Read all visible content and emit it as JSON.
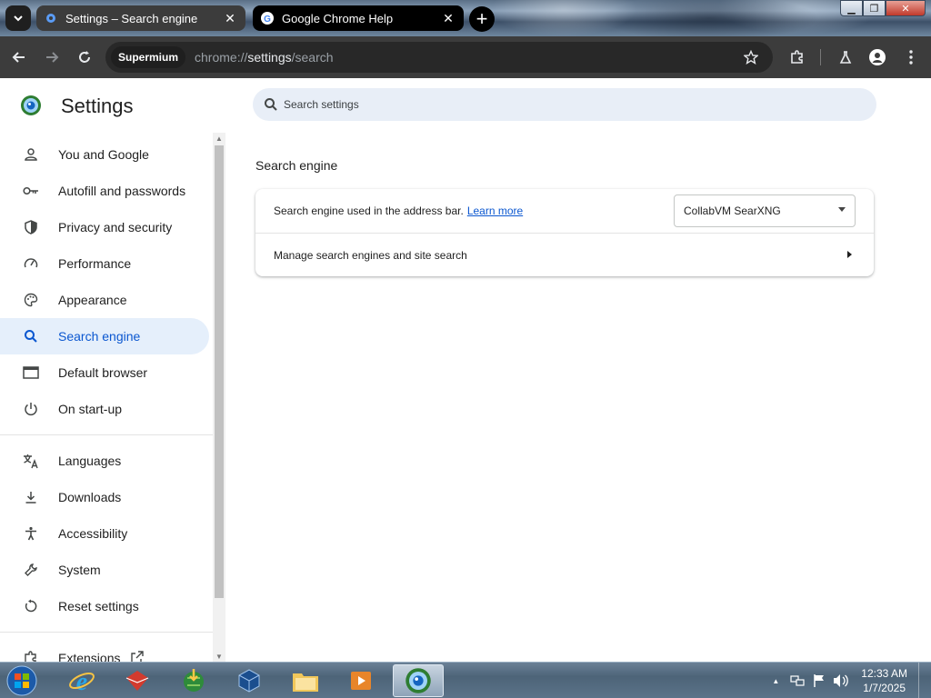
{
  "tabs": [
    {
      "title": "Settings – Search engine",
      "favicon": "gear-icon",
      "active": true
    },
    {
      "title": "Google Chrome Help",
      "favicon": "google-g-icon",
      "active": false
    }
  ],
  "toolbar": {
    "chip": "Supermium",
    "url_scheme": "chrome://",
    "url_host": "settings",
    "url_path": "/search"
  },
  "settings": {
    "title": "Settings",
    "search_placeholder": "Search settings"
  },
  "sidebar": {
    "items": [
      {
        "label": "You and Google",
        "icon": "person-icon"
      },
      {
        "label": "Autofill and passwords",
        "icon": "key-icon"
      },
      {
        "label": "Privacy and security",
        "icon": "shield-icon"
      },
      {
        "label": "Performance",
        "icon": "gauge-icon"
      },
      {
        "label": "Appearance",
        "icon": "palette-icon"
      },
      {
        "label": "Search engine",
        "icon": "search-icon",
        "active": true
      },
      {
        "label": "Default browser",
        "icon": "browser-window-icon"
      },
      {
        "label": "On start-up",
        "icon": "power-icon"
      }
    ],
    "items2": [
      {
        "label": "Languages",
        "icon": "translate-icon"
      },
      {
        "label": "Downloads",
        "icon": "download-icon"
      },
      {
        "label": "Accessibility",
        "icon": "accessibility-icon"
      },
      {
        "label": "System",
        "icon": "wrench-icon"
      },
      {
        "label": "Reset settings",
        "icon": "reset-icon"
      }
    ],
    "extensions": "Extensions"
  },
  "main": {
    "section_title": "Search engine",
    "row1_label": "Search engine used in the address bar.",
    "row1_link": "Learn more",
    "select_value": "CollabVM SearXNG",
    "row2_label": "Manage search engines and site search"
  },
  "taskbar": {
    "time": "12:33 AM",
    "date": "1/7/2025"
  }
}
